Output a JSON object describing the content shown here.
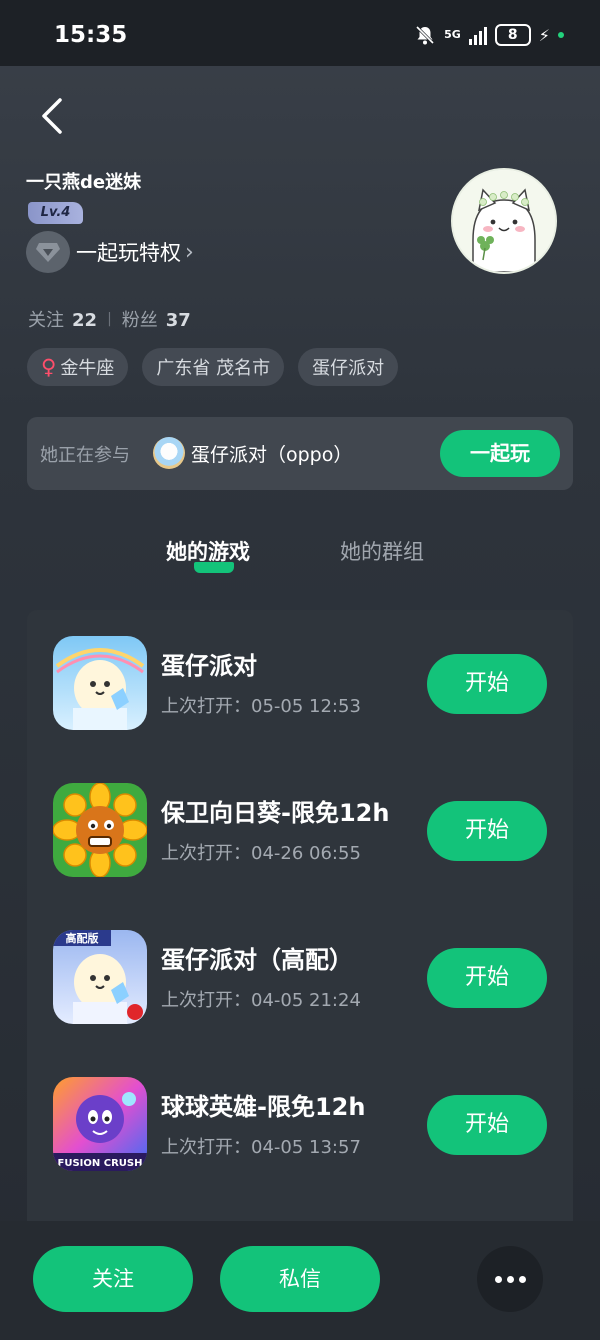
{
  "status_bar": {
    "time": "15:35",
    "network": "5G",
    "battery": "8"
  },
  "profile": {
    "username": "一只燕de迷妹",
    "level": "Lv.4",
    "privilege_label": "一起玩特权",
    "stats": {
      "following_label": "关注",
      "following_count": "22",
      "followers_label": "粉丝",
      "followers_count": "37"
    },
    "tags": [
      "金牛座",
      "广东省 茂名市",
      "蛋仔派对"
    ]
  },
  "currently_playing": {
    "label": "她正在参与",
    "game": "蛋仔派对（oppo）",
    "button": "一起玩"
  },
  "tabs": [
    {
      "label": "她的游戏",
      "active": true
    },
    {
      "label": "她的群组",
      "active": false
    }
  ],
  "games": [
    {
      "title": "蛋仔派对",
      "last_opened": "上次打开：05-05 12:53",
      "button": "开始",
      "icon": "eggy-party-icon"
    },
    {
      "title": "保卫向日葵-限免12h",
      "last_opened": "上次打开：04-26 06:55",
      "button": "开始",
      "icon": "sunflower-icon"
    },
    {
      "title": "蛋仔派对（高配）",
      "last_opened": "上次打开：04-05 21:24",
      "button": "开始",
      "icon": "eggy-party-hd-icon",
      "icon_badge": "高配版"
    },
    {
      "title": "球球英雄-限免12h",
      "last_opened": "上次打开：04-05 13:57",
      "button": "开始",
      "icon": "fusion-crush-icon",
      "icon_caption": "FUSION CRUSH"
    }
  ],
  "bottom_bar": {
    "follow": "关注",
    "message": "私信"
  },
  "colors": {
    "accent": "#13c37a",
    "background": "#2e343c",
    "card": "#41474f",
    "venus": "#ff4e6b"
  }
}
